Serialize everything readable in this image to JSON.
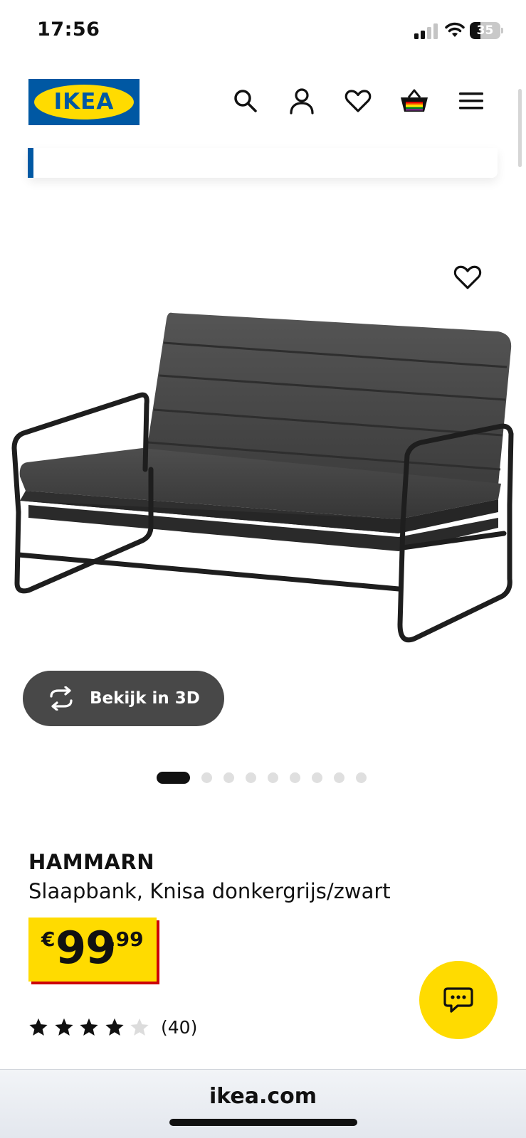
{
  "status_bar": {
    "time": "17:56",
    "battery_level": "35"
  },
  "header": {
    "logo_text": "IKEA",
    "logo_reg_mark": "®",
    "icons": [
      "search-icon",
      "account-icon",
      "favourites-icon",
      "cart-icon",
      "menu-icon"
    ]
  },
  "gallery": {
    "view_3d_label": "Bekijk in 3D",
    "image_count": 9,
    "active_index": 0
  },
  "product": {
    "name": "HAMMARN",
    "description": "Slaapbank, Knisa donkergrijs/zwart",
    "price_currency": "€",
    "price_integer": "99",
    "price_decimal": ".99",
    "rating_stars": 4,
    "rating_max": 5,
    "rating_count": "(40)"
  },
  "browser": {
    "url": "ikea.com"
  },
  "colors": {
    "ikea_blue": "#0058a3",
    "ikea_yellow": "#ffdb00",
    "price_shadow_red": "#cc0008",
    "button_grey": "#484848"
  }
}
